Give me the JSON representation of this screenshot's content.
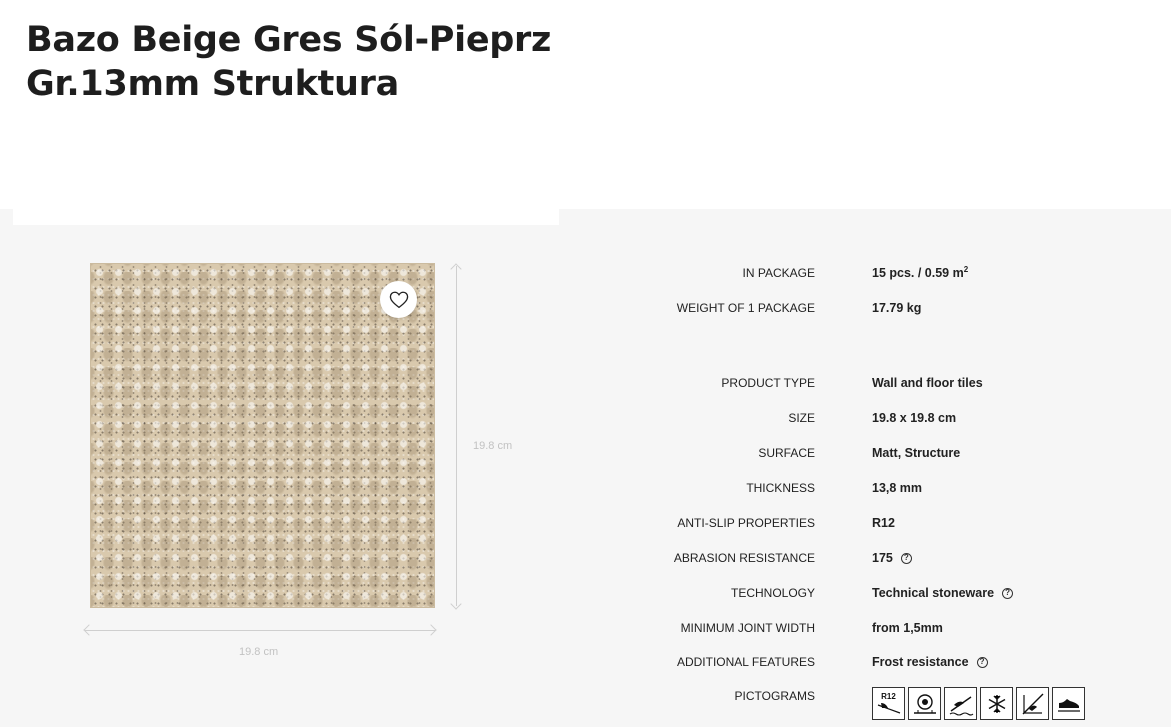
{
  "product": {
    "title": "Bazo Beige Gres Sól-Pieprz Gr.13mm Struktura"
  },
  "image": {
    "width_label": "19.8 cm",
    "height_label": "19.8 cm",
    "tile_color": "#d9c9ad"
  },
  "specs": {
    "in_package": {
      "label": "IN PACKAGE",
      "value": "15 pcs. / 0.59 m",
      "unit_sup": "2"
    },
    "weight": {
      "label": "WEIGHT OF 1 PACKAGE",
      "value": "17.79 kg"
    },
    "product_type": {
      "label": "PRODUCT TYPE",
      "value": "Wall and floor tiles"
    },
    "size": {
      "label": "SIZE",
      "value": "19.8 x 19.8 cm"
    },
    "surface": {
      "label": "SURFACE",
      "value": "Matt, Structure"
    },
    "thickness": {
      "label": "THICKNESS",
      "value": "13,8 mm"
    },
    "anti_slip": {
      "label": "ANTI-SLIP PROPERTIES",
      "value": "R12"
    },
    "abrasion": {
      "label": "ABRASION RESISTANCE",
      "value": "175"
    },
    "technology": {
      "label": "TECHNOLOGY",
      "value": "Technical stoneware"
    },
    "joint_width": {
      "label": "MINIMUM JOINT WIDTH",
      "value": "from 1,5mm"
    },
    "features": {
      "label": "ADDITIONAL FEATURES",
      "value": "Frost resistance"
    },
    "pictograms": {
      "label": "PICTOGRAMS"
    }
  },
  "pictograms": {
    "r12_text": "R12",
    "items": [
      "r12-antislip-icon",
      "abrasion-icon",
      "wet-floor-icon",
      "frost-icon",
      "no-slip-icon",
      "shoe-icon"
    ]
  },
  "icons": {
    "favorite": "heart-icon",
    "help": "question-circle-icon",
    "help_glyph": "?"
  }
}
